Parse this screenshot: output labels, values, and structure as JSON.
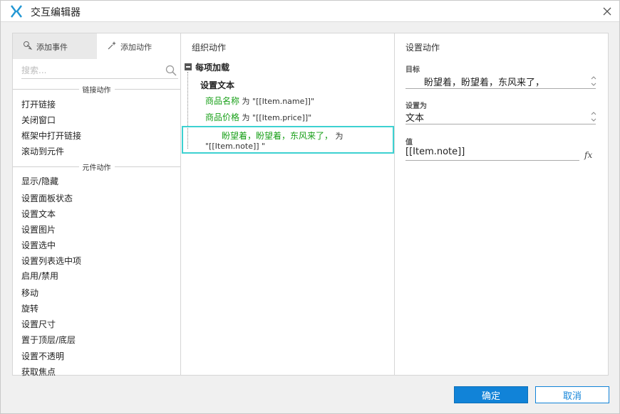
{
  "window": {
    "title": "交互编辑器",
    "close_icon": "close-icon",
    "accent": "#1183d8"
  },
  "left": {
    "tabs": [
      {
        "label": "添加事件",
        "icon": "add-event-icon",
        "active": true
      },
      {
        "label": "添加动作",
        "icon": "add-action-icon",
        "active": false
      }
    ],
    "search_placeholder": "搜索...",
    "sections": [
      {
        "label": "链接动作",
        "items": [
          "打开链接",
          "关闭窗口",
          "框架中打开链接",
          "滚动到元件"
        ]
      },
      {
        "label": "元件动作",
        "items": [
          "显示/隐藏",
          "设置面板状态",
          "设置文本",
          "设置图片",
          "设置选中",
          "设置列表选中项",
          "启用/禁用",
          "移动",
          "旋转",
          "设置尺寸",
          "置于顶层/底层",
          "设置不透明",
          "获取焦点"
        ]
      }
    ]
  },
  "middle": {
    "title": "组织动作",
    "event": "每项加载",
    "action": "设置文本",
    "rows": [
      {
        "target": "商品名称",
        "word": "为",
        "value": "\"[[Item.name]]\""
      },
      {
        "target": "商品价格",
        "word": "为",
        "value": "\"[[Item.price]]\""
      },
      {
        "target": "盼望着，盼望着，东风来了，",
        "word": "为",
        "value": "\"[[Item.note]]  \""
      }
    ]
  },
  "right": {
    "title": "设置动作",
    "target_label": "目标",
    "target_value": "盼望着，盼望着，东风来了，",
    "setas_label": "设置为",
    "setas_value": "文本",
    "value_label": "值",
    "value_value": "[[Item.note]]",
    "fx_label": "fx"
  },
  "footer": {
    "ok_label": "确定",
    "cancel_label": "取消"
  }
}
